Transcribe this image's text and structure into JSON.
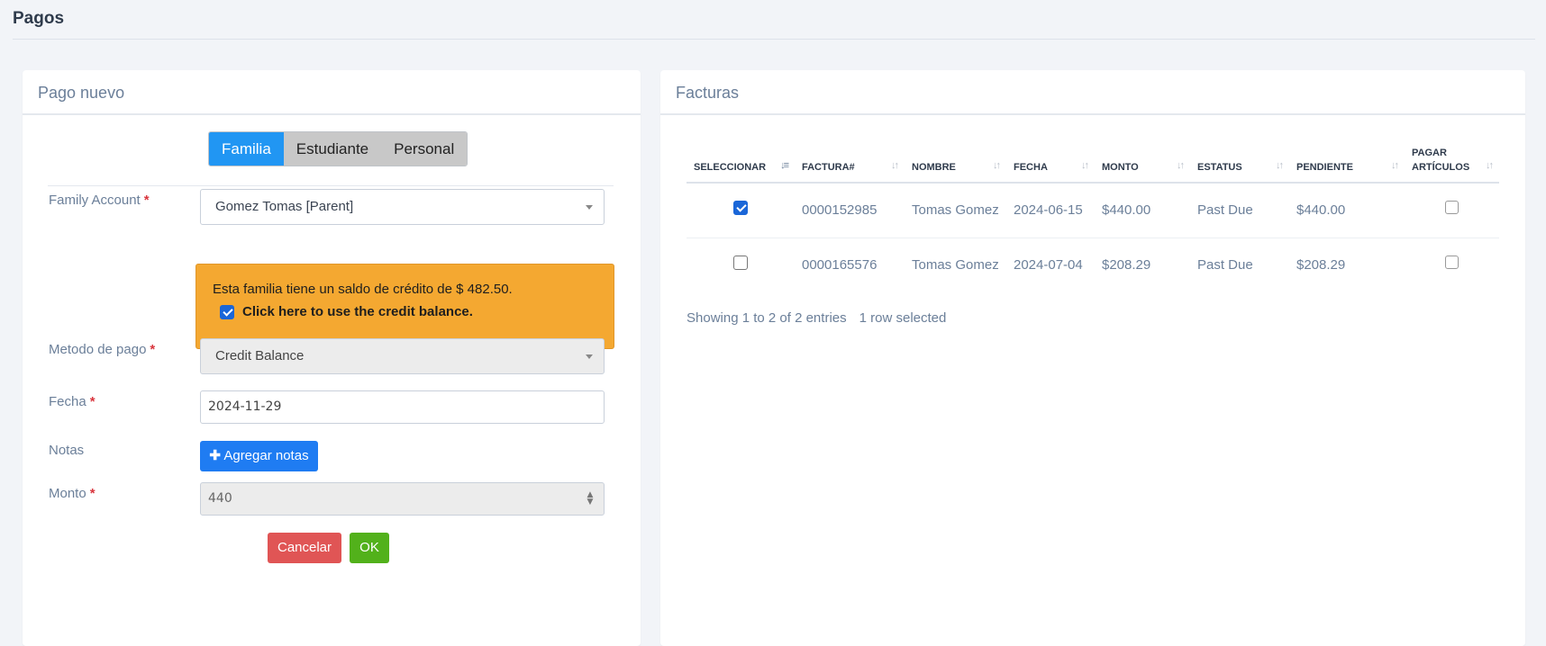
{
  "page": {
    "title": "Pagos"
  },
  "left_panel": {
    "title": "Pago nuevo",
    "toggle": [
      "Familia",
      "Estudiante",
      "Personal"
    ],
    "family_account_label": "Family Account",
    "family_account_value": "Gomez Tomas [Parent]",
    "alert": {
      "text": "Esta familia tiene un saldo de crédito de $ 482.50.",
      "checkbox_label": "Click here to use the credit balance.",
      "checked": true
    },
    "payment_method_label": "Metodo de pago",
    "payment_method_value": "Credit Balance",
    "date_label": "Fecha",
    "date_value": "2024-11-29",
    "notes_label": "Notas",
    "add_notes_button": "Agregar notas",
    "amount_label": "Monto",
    "amount_value": "440",
    "cancel_button": "Cancelar",
    "ok_button": "OK",
    "required_mark": "*"
  },
  "right_panel": {
    "title": "Facturas",
    "columns": [
      "SELECCIONAR",
      "FACTURA#",
      "NOMBRE",
      "FECHA",
      "MONTO",
      "ESTATUS",
      "PENDIENTE",
      "PAGAR ARTÍCULOS"
    ],
    "rows": [
      {
        "selected": true,
        "invoice": "0000152985",
        "name": "Tomas Gomez",
        "date": "2024-06-15",
        "amount": "$440.00",
        "status": "Past Due",
        "pending": "$440.00",
        "pay_items": false
      },
      {
        "selected": false,
        "invoice": "0000165576",
        "name": "Tomas Gomez",
        "date": "2024-07-04",
        "amount": "$208.29",
        "status": "Past Due",
        "pending": "$208.29",
        "pay_items": false
      }
    ],
    "info": "Showing 1 to 2 of 2 entries",
    "selected_info": "1 row selected"
  },
  "colors": {
    "primary": "#2196f3",
    "warning": "#f4a831",
    "danger": "#e05555",
    "success": "#52b11b"
  }
}
